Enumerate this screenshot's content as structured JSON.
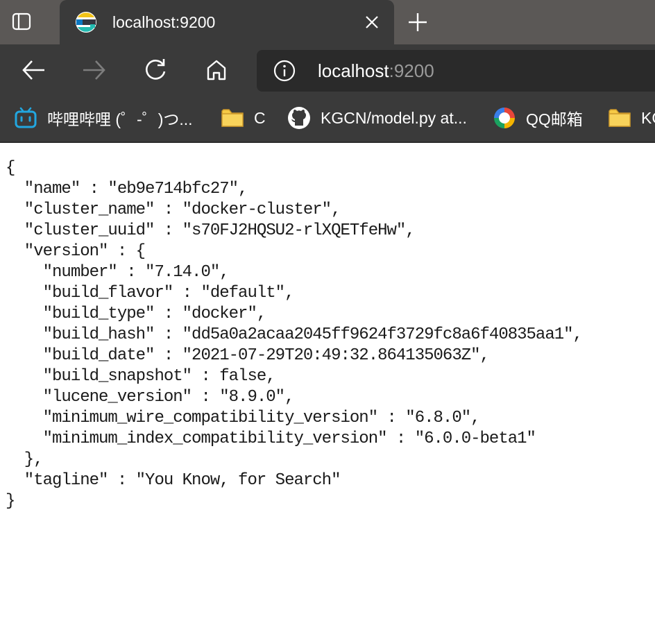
{
  "browser": {
    "tab": {
      "title": "localhost:9200",
      "favicon": "elastic-icon"
    },
    "toolbar": {
      "address_host": "localhost",
      "address_port": ":9200"
    },
    "bookmarks": [
      {
        "label": "哔哩哔哩 (゜-゜)つ...",
        "icon": "bilibili-icon"
      },
      {
        "label": "C",
        "icon": "folder-icon"
      },
      {
        "label": "KGCN/model.py at...",
        "icon": "github-icon"
      },
      {
        "label": "QQ邮箱",
        "icon": "qqmail-icon"
      },
      {
        "label": "KG",
        "icon": "folder-icon"
      }
    ],
    "colors": {
      "tabstrip": "#5b5856",
      "toolbar": "#3a3a3a",
      "address_bar": "#2a2a2a",
      "folder": "#f6c945"
    }
  },
  "page": {
    "json_text": "{\n  \"name\" : \"eb9e714bfc27\",\n  \"cluster_name\" : \"docker-cluster\",\n  \"cluster_uuid\" : \"s70FJ2HQSU2-rlXQETfeHw\",\n  \"version\" : {\n    \"number\" : \"7.14.0\",\n    \"build_flavor\" : \"default\",\n    \"build_type\" : \"docker\",\n    \"build_hash\" : \"dd5a0a2acaa2045ff9624f3729fc8a6f40835aa1\",\n    \"build_date\" : \"2021-07-29T20:49:32.864135063Z\",\n    \"build_snapshot\" : false,\n    \"lucene_version\" : \"8.9.0\",\n    \"minimum_wire_compatibility_version\" : \"6.8.0\",\n    \"minimum_index_compatibility_version\" : \"6.0.0-beta1\"\n  },\n  \"tagline\" : \"You Know, for Search\"\n}"
  }
}
